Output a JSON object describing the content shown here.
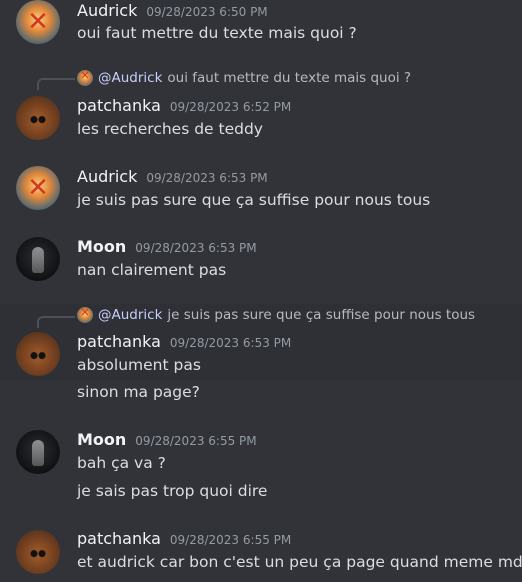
{
  "messages": [
    {
      "author": "Audrick",
      "timestamp": "09/28/2023 6:50 PM",
      "lines": [
        "oui faut mettre du texte mais quoi ?"
      ]
    },
    {
      "reply_to": {
        "mention": "@Audrick",
        "text": "oui faut mettre du texte mais quoi ?"
      },
      "author": "patchanka",
      "timestamp": "09/28/2023 6:52 PM",
      "lines": [
        "les recherches de teddy"
      ]
    },
    {
      "author": "Audrick",
      "timestamp": "09/28/2023 6:53 PM",
      "lines": [
        "je suis pas sure que ça suffise pour nous tous"
      ]
    },
    {
      "author": "Moon",
      "timestamp": "09/28/2023 6:53 PM",
      "lines": [
        "nan clairement pas"
      ]
    },
    {
      "reply_to": {
        "mention": "@Audrick",
        "text": "je suis pas sure que ça suffise pour nous tous"
      },
      "author": "patchanka",
      "timestamp": "09/28/2023 6:53 PM",
      "lines": [
        "absolument pas",
        "sinon ma page?"
      ]
    },
    {
      "author": "Moon",
      "timestamp": "09/28/2023 6:55 PM",
      "lines": [
        "bah ça va ?",
        "je sais pas trop quoi dire"
      ]
    },
    {
      "author": "patchanka",
      "timestamp": "09/28/2023 6:55 PM",
      "lines": [
        "et audrick car bon c'est un peu ça page quand meme mdr"
      ]
    }
  ],
  "colors": {
    "background": "#313338",
    "highlight": "#2e3035",
    "name": "#f2f3f5",
    "timestamp": "#949ba4",
    "text": "#dbdee1",
    "mention": "#c9cdfb"
  }
}
